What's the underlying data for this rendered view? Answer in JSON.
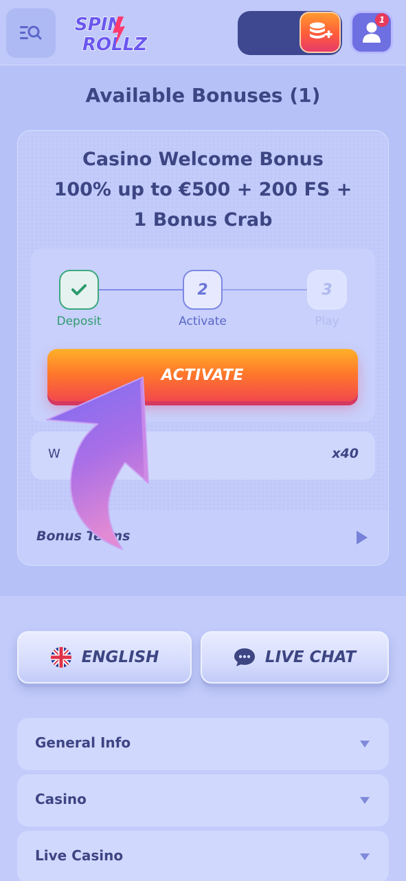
{
  "header": {
    "logo_line1": "SPIN",
    "logo_line2": "ROLLZ",
    "profile_badge": "1",
    "menu_icon": "search-list-icon",
    "deposit_icon": "coins-plus-icon",
    "profile_icon": "user-icon"
  },
  "bonuses": {
    "title": "Available Bonuses (1)",
    "card": {
      "title_lines": [
        "Casino Welcome Bonus",
        "100% up to €500 + 200 FS +",
        "1 Bonus Crab"
      ],
      "steps": [
        {
          "label": "Deposit",
          "state": "done"
        },
        {
          "number": "2",
          "label": "Activate",
          "state": "current"
        },
        {
          "number": "3",
          "label": "Play",
          "state": "pending"
        }
      ],
      "activate_label": "ACTIVATE",
      "wager_label_visible": "W",
      "wager_value": "x40",
      "terms_label_visible": "Bonus Terms"
    }
  },
  "footer": {
    "language_label": "ENGLISH",
    "chat_label": "LIVE CHAT",
    "accordions": [
      "General Info",
      "Casino",
      "Live Casino"
    ]
  },
  "colors": {
    "accent": "#3d4583",
    "background": "#b7c2f6",
    "cta_top": "#ffb12a",
    "cta_bottom": "#f2484c",
    "success": "#3aa87d"
  }
}
